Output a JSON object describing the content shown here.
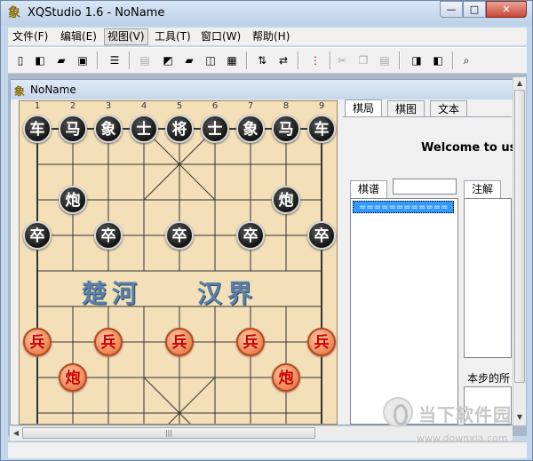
{
  "window": {
    "title": "XQStudio 1.6 - NoName",
    "min_label": "—",
    "max_label": "□",
    "close_label": "✕"
  },
  "menu": [
    {
      "label": "文件(F)"
    },
    {
      "label": "编辑(E)"
    },
    {
      "label": "视图(V)"
    },
    {
      "label": "工具(T)"
    },
    {
      "label": "窗口(W)"
    },
    {
      "label": "帮助(H)"
    }
  ],
  "toolbar": {
    "icons": [
      "new-icon",
      "open-icon",
      "folder-icon",
      "save-icon",
      "list-icon",
      "record-icon",
      "export-icon",
      "import-folder-icon",
      "copy-board-icon",
      "edit-board-icon",
      "flip-vertical-icon",
      "swap-icon",
      "moves-icon",
      "cut-icon",
      "copy-icon",
      "paste-icon",
      "page-prev-icon",
      "page-next-icon",
      "preview-icon"
    ]
  },
  "child": {
    "title": "NoName"
  },
  "board": {
    "column_numbers": [
      "1",
      "2",
      "3",
      "4",
      "5",
      "6",
      "7",
      "8",
      "9"
    ],
    "river_left": "楚河",
    "river_right": "汉界",
    "black_back": [
      "车",
      "马",
      "象",
      "士",
      "将",
      "士",
      "象",
      "马",
      "车"
    ],
    "black_cannon": "炮",
    "black_soldier": "卒",
    "red_soldier": "兵",
    "red_cannon": "炮"
  },
  "panel": {
    "tabs": [
      {
        "label": "棋局"
      },
      {
        "label": "棋图"
      },
      {
        "label": "文本"
      }
    ],
    "welcome": "Welcome to use",
    "record_label": "棋谱",
    "comment_label": "注解",
    "record_item": "============",
    "step_label": "本步的所"
  },
  "watermark": {
    "text": "当下软件园",
    "url": "www.downxia.com"
  }
}
